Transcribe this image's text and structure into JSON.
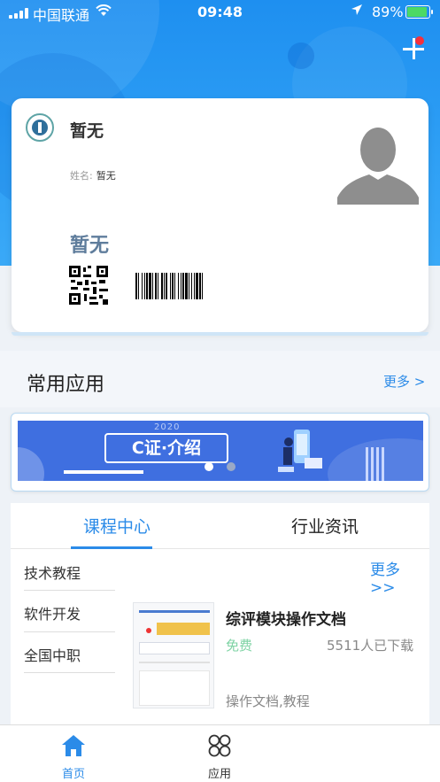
{
  "status_bar": {
    "carrier": "中国联通",
    "time": "09:48",
    "battery": "89%"
  },
  "card": {
    "org_name": "暂无",
    "name_label": "姓名:",
    "name_value": "暂无",
    "display_name": "暂无"
  },
  "common_apps": {
    "title": "常用应用",
    "more": "更多 >"
  },
  "banner": {
    "year": "2020",
    "title": "C证·介绍"
  },
  "courses": {
    "tabs": [
      {
        "label": "课程中心",
        "active": true
      },
      {
        "label": "行业资讯",
        "active": false
      }
    ],
    "categories": [
      "技术教程",
      "软件开发",
      "全国中职"
    ],
    "more": "更多 >>",
    "item": {
      "title": "综评模块操作文档",
      "price": "免费",
      "downloads": "5511人已下载",
      "tags": "操作文档,教程"
    }
  },
  "tabbar": {
    "items": [
      {
        "label": "首页",
        "icon": "home-icon",
        "active": true
      },
      {
        "label": "应用",
        "icon": "apps-icon",
        "active": false
      }
    ]
  },
  "colors": {
    "primary": "#2b8be8",
    "header": "#1e8ff0",
    "free": "#7ed3a4"
  }
}
